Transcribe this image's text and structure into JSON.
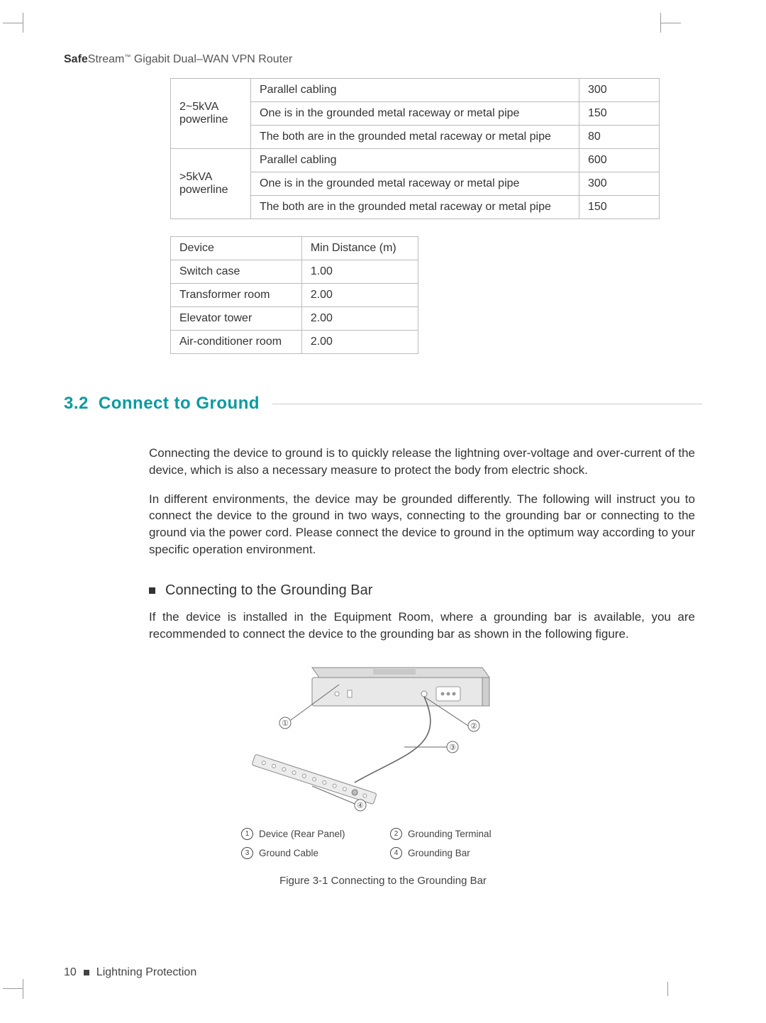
{
  "header": {
    "brand_bold": "Safe",
    "brand_rest": "Stream",
    "tm": "™",
    "product": " Gigabit Dual–WAN VPN Router"
  },
  "table1": {
    "rows": [
      {
        "cat": "2~5kVA powerline",
        "desc": "Parallel cabling",
        "val": "300"
      },
      {
        "cat": "",
        "desc": "One is in the grounded metal raceway or metal pipe",
        "val": "150"
      },
      {
        "cat": "",
        "desc": "The both are in the grounded metal raceway or metal pipe",
        "val": "80"
      },
      {
        "cat": ">5kVA powerline",
        "desc": "Parallel cabling",
        "val": "600"
      },
      {
        "cat": "",
        "desc": "One is in the grounded metal raceway or metal pipe",
        "val": "300"
      },
      {
        "cat": "",
        "desc": "The both are in the grounded metal raceway or metal pipe",
        "val": "150"
      }
    ]
  },
  "table2": {
    "head": {
      "c1": "Device",
      "c2": "Min Distance (m)"
    },
    "rows": [
      {
        "c1": "Switch case",
        "c2": "1.00"
      },
      {
        "c1": "Transformer room",
        "c2": "2.00"
      },
      {
        "c1": "Elevator tower",
        "c2": "2.00"
      },
      {
        "c1": "Air-conditioner room",
        "c2": "2.00"
      }
    ]
  },
  "section": {
    "num": "3.2",
    "title": "Connect to Ground"
  },
  "para1": "Connecting the device to ground is to quickly release the lightning over-voltage and over-current of the device, which is also a necessary measure to protect the body from electric shock.",
  "para2": "In different environments, the device may be grounded differently. The following will instruct you to connect the device to the ground in two ways, connecting to the grounding bar or connecting to the ground via the power cord. Please connect the device to ground in the optimum way according to your specific operation environment.",
  "subhead": "Connecting to the Grounding Bar",
  "para3": "If the device is installed in the Equipment Room, where a grounding bar is available, you are recommended to connect the device to the grounding bar as shown in the following figure.",
  "figure": {
    "labels": {
      "l1": "①",
      "l2": "②",
      "l3": "③",
      "l4": "④"
    },
    "legend": [
      {
        "n": "1",
        "t": "Device (Rear Panel)"
      },
      {
        "n": "2",
        "t": "Grounding Terminal"
      },
      {
        "n": "3",
        "t": "Ground Cable"
      },
      {
        "n": "4",
        "t": "Grounding Bar"
      }
    ],
    "caption": "Figure 3-1   Connecting to the Grounding Bar"
  },
  "footer": {
    "page": "10",
    "chapter": "Lightning Protection"
  }
}
